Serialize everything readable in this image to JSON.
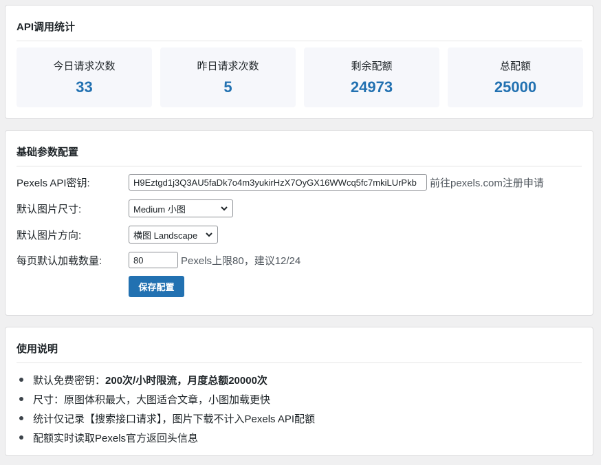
{
  "stats_card": {
    "title": "API调用统计",
    "items": [
      {
        "label": "今日请求次数",
        "value": "33"
      },
      {
        "label": "昨日请求次数",
        "value": "5"
      },
      {
        "label": "剩余配额",
        "value": "24973"
      },
      {
        "label": "总配额",
        "value": "25000"
      }
    ]
  },
  "config_card": {
    "title": "基础参数配置",
    "api_key": {
      "label": "Pexels API密钥:",
      "value": "H9Eztgd1j3Q3AU5faDk7o4m3yukirHzX7OyGX16WWcq5fc7mkiLUrPkb",
      "link_text": "前往pexels.com注册申请"
    },
    "size": {
      "label": "默认图片尺寸:",
      "selected": "Medium 小图"
    },
    "orientation": {
      "label": "默认图片方向:",
      "selected": "横图 Landscape"
    },
    "per_page": {
      "label": "每页默认加载数量:",
      "value": "80",
      "hint": "Pexels上限80，建议12/24"
    },
    "save_label": "保存配置"
  },
  "usage_card": {
    "title": "使用说明",
    "items": [
      {
        "prefix": "默认免费密钥：",
        "bold": "200次/小时限流，月度总额20000次"
      },
      {
        "prefix": "尺寸：原图体积最大，大图适合文章，小图加载更快",
        "bold": ""
      },
      {
        "prefix": "统计仅记录【搜索接口请求】，图片下载不计入Pexels API配额",
        "bold": ""
      },
      {
        "prefix": "配额实时读取Pexels官方返回头信息",
        "bold": ""
      }
    ]
  },
  "colors": {
    "accent": "#2271b1",
    "stat_bg": "#f6f7fb",
    "page_bg": "#f0f0f1"
  }
}
